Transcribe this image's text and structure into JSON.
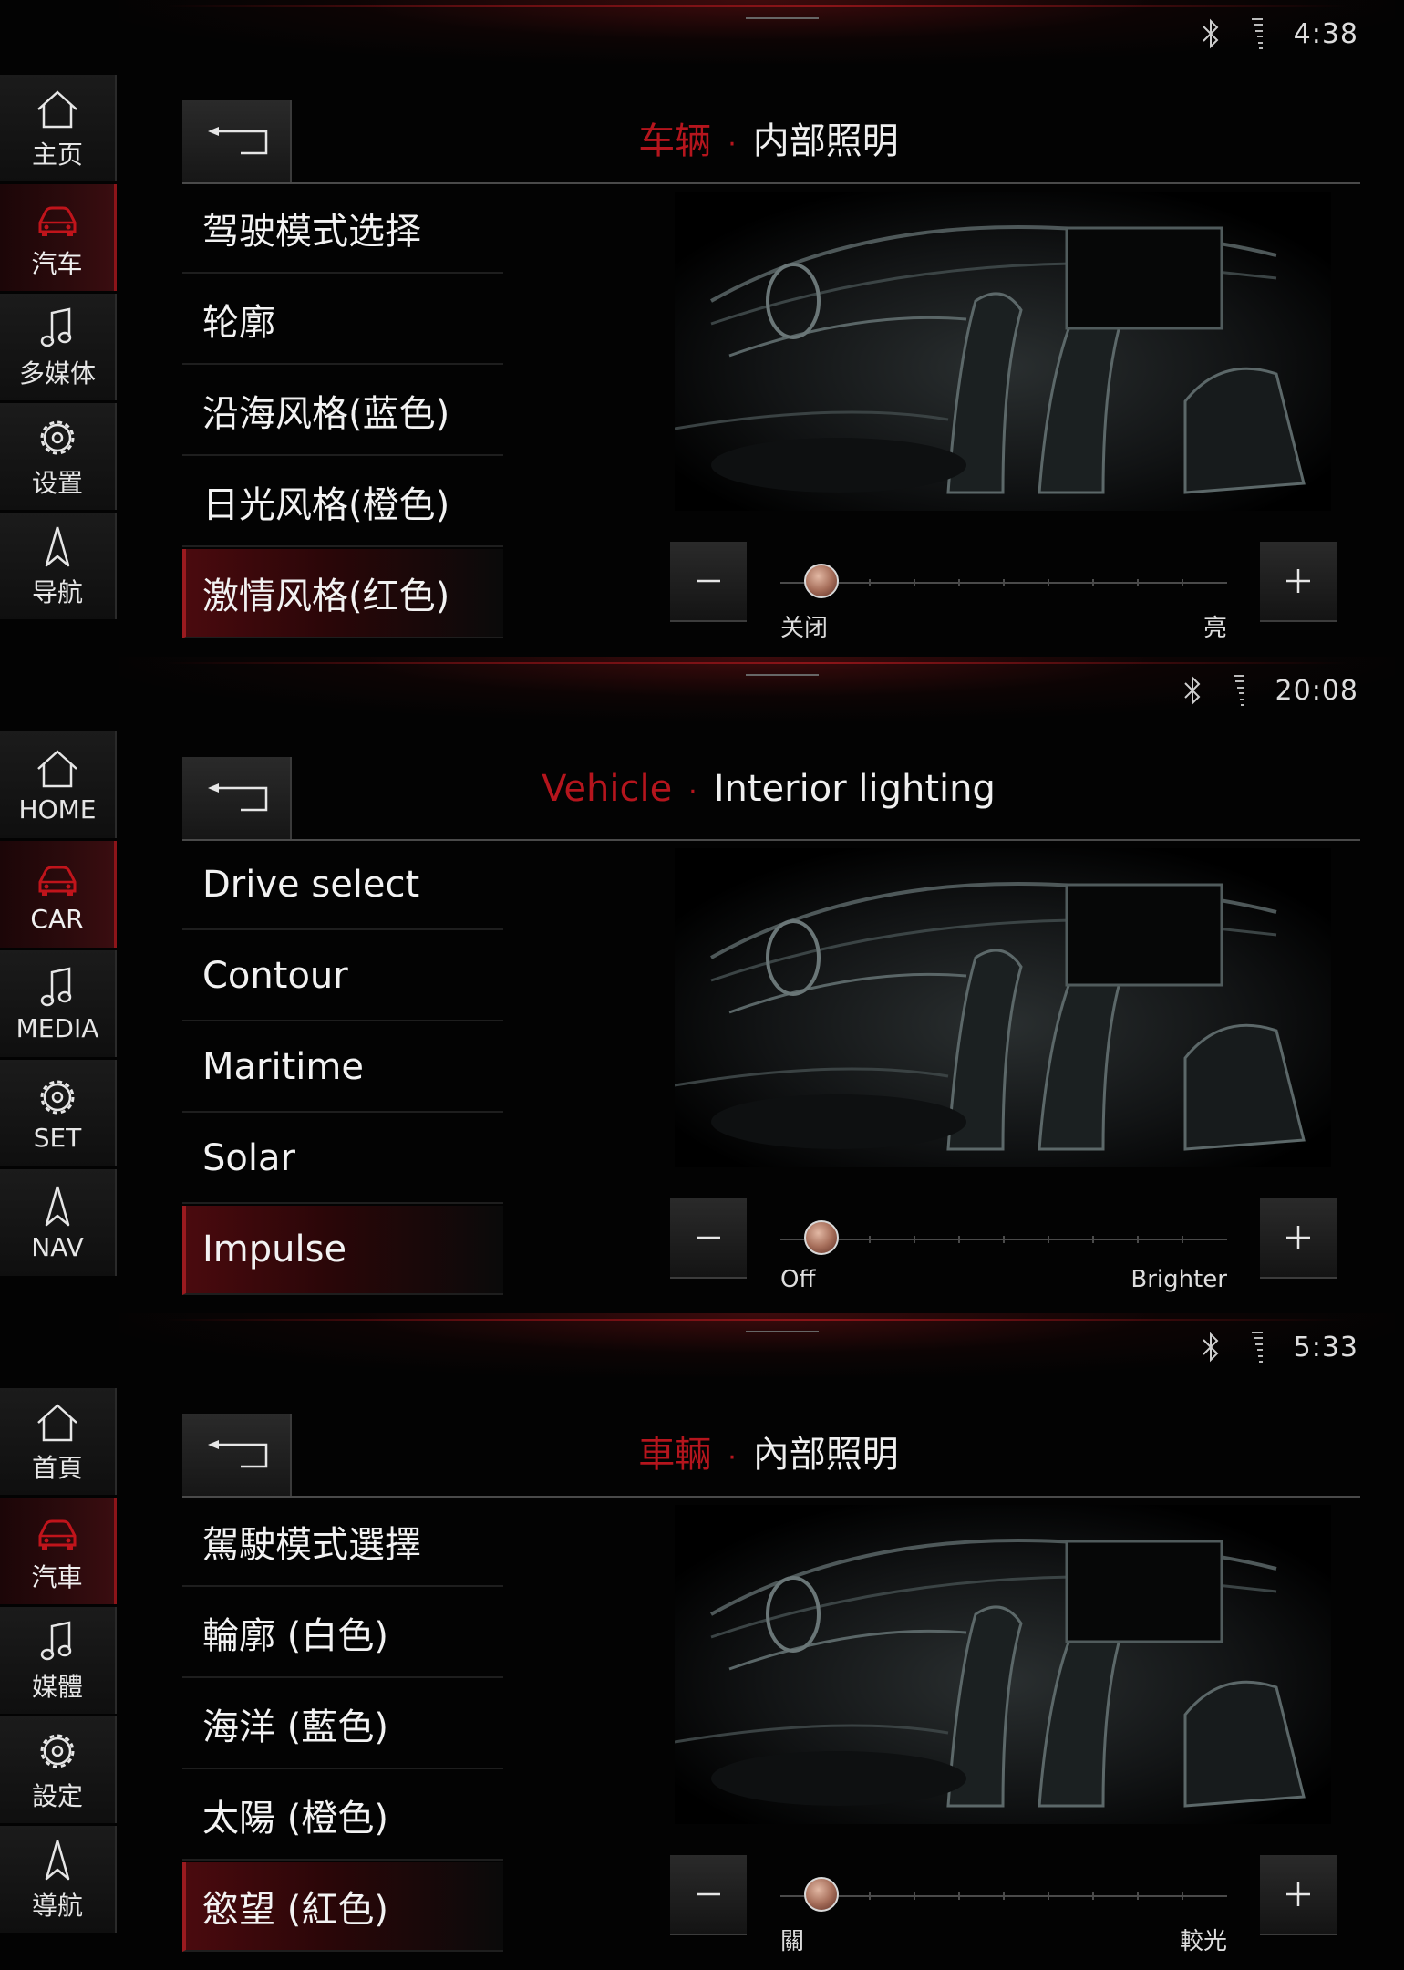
{
  "accent_color": "#b5151d",
  "screens": [
    {
      "clock": "4:38",
      "nav": [
        {
          "label": "主页",
          "icon": "home-icon"
        },
        {
          "label": "汽车",
          "icon": "car-icon"
        },
        {
          "label": "多媒体",
          "icon": "music-note-icon"
        },
        {
          "label": "设置",
          "icon": "gear-icon"
        },
        {
          "label": "导航",
          "icon": "navigation-arrow-icon"
        }
      ],
      "title_crumb": "车辆",
      "title_current": "内部照明",
      "menu": [
        "驾驶模式选择",
        "轮廓",
        "沿海风格(蓝色)",
        "日光风格(橙色)",
        "激情风格(红色)"
      ],
      "slider": {
        "min_label": "关闭",
        "max_label": "亮",
        "value": 0
      }
    },
    {
      "clock": "20:08",
      "nav": [
        {
          "label": "HOME",
          "icon": "home-icon"
        },
        {
          "label": "CAR",
          "icon": "car-icon"
        },
        {
          "label": "MEDIA",
          "icon": "music-note-icon"
        },
        {
          "label": "SET",
          "icon": "gear-icon"
        },
        {
          "label": "NAV",
          "icon": "navigation-arrow-icon"
        }
      ],
      "title_crumb": "Vehicle",
      "title_current": "Interior lighting",
      "menu": [
        "Drive select",
        "Contour",
        "Maritime",
        "Solar",
        "Impulse"
      ],
      "slider": {
        "min_label": "Off",
        "max_label": "Brighter",
        "value": 0
      }
    },
    {
      "clock": "5:33",
      "nav": [
        {
          "label": "首頁",
          "icon": "home-icon"
        },
        {
          "label": "汽車",
          "icon": "car-icon"
        },
        {
          "label": "媒體",
          "icon": "music-note-icon"
        },
        {
          "label": "設定",
          "icon": "gear-icon"
        },
        {
          "label": "導航",
          "icon": "navigation-arrow-icon"
        }
      ],
      "title_crumb": "車輛",
      "title_current": "內部照明",
      "menu": [
        "駕駛模式選擇",
        "輪廓 (白色)",
        "海洋 (藍色)",
        "太陽 (橙色)",
        "慾望 (紅色)"
      ],
      "slider": {
        "min_label": "關",
        "max_label": "較光",
        "value": 0
      }
    }
  ]
}
